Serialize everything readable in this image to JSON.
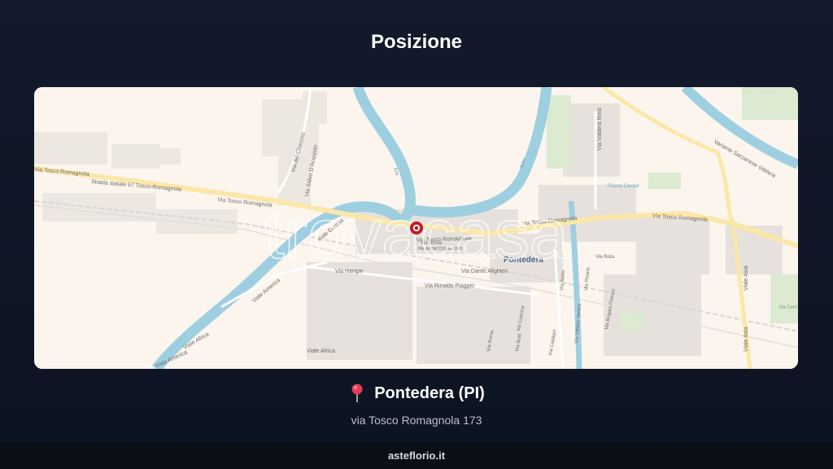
{
  "title": "Posizione",
  "map": {
    "labels": {
      "road_tosco_left": "Via Tosco Romagnola",
      "road_ss67": "Strada statale 67 Tosco-Romagnola",
      "road_tosco_center": "Via Tosco Romagnola",
      "road_tosco_center2": "Via Tosco Romagnola",
      "road_tosco_right": "Via Tosco Romagnola",
      "road_tosco_far_right": "Via Tosco Romagnola",
      "city": "Pontedera",
      "road_dante": "Via Dante Alighieri",
      "road_hangar": "Via Hangar",
      "road_piaggio": "Via Rinaldo Piaggio",
      "road_america": "Viale America",
      "road_america2": "Viale America",
      "road_africa": "Viale Africa",
      "road_africa2": "Viale Africa",
      "road_asia": "Viale Asia",
      "road_asia2": "Viale Asia",
      "road_valdera_nord": "Via Valdera Nord",
      "road_variante": "Variante Sarzanese Valdera",
      "road_d_acquisto": "Via Salvo D'Acquisto",
      "road_del_chiesino": "Via del Chiesino",
      "road_europa": "Viale Europa",
      "piazza": "Piazza Cavour",
      "road_vittorio": "Via Vittorio Veneto",
      "road_roma": "Via Roma",
      "road_botti": "Via Botti",
      "road_catalani": "Via Catalani",
      "road_rota": "Via Rota",
      "road_salvo": "Via Salvo",
      "road_pisana": "Via Pisana",
      "road_brigata": "Via Brigata Firenze",
      "road_cerri": "Via Cerri",
      "road_palazzaccio": "PALAZZACCIO NUOVO",
      "road_bruna": "Via Bruna",
      "road_cascine": "Via Cascine",
      "river_era": "Era",
      "river_arno": "Arno"
    },
    "watermark": "trovacasa",
    "marker_icon": "location-marker-icon"
  },
  "location": {
    "pin_icon": "pushpin-icon",
    "city": "Pontedera (PI)",
    "address": "via Tosco Romagnola 173"
  },
  "footer": {
    "site": "asteflorio.it"
  },
  "colors": {
    "background": "#121a2b",
    "marker": "#c0182a",
    "water": "#9ecfe0",
    "road_major": "#fbe7a8",
    "footer_bg": "#0a0e17"
  }
}
